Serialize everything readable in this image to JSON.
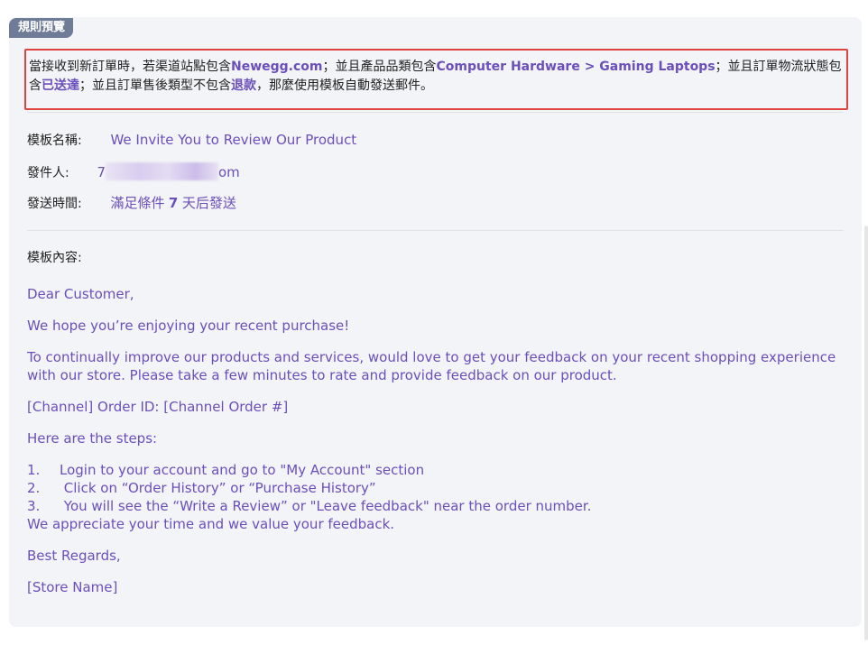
{
  "tab": {
    "label": "規則預覽"
  },
  "rule": {
    "text_1": "當接收到新訂單時，若渠道站點包含",
    "channel": "Newegg.com",
    "text_2": "；並且產品品類包含",
    "category": "Computer Hardware > Gaming Laptops",
    "text_3": "；並且訂單物流狀態包含",
    "logistics": "已送達",
    "text_4": "；並且訂單售後類型不包含",
    "aftersale": "退款",
    "text_5": "，那麼使用模板自動發送郵件。"
  },
  "fields": {
    "template_name_label": "模板名稱:",
    "template_name_value": "We Invite You to Review Our Product",
    "sender_label": "發件人:",
    "sender_prefix": "7",
    "sender_suffix": "om",
    "send_time_label": "發送時間:",
    "send_time_text_1": "滿足條件",
    "send_time_days": "7",
    "send_time_text_2": "天后發送"
  },
  "content": {
    "label": "模板內容:",
    "greeting": "Dear Customer,",
    "line1": "We hope you’re enjoying your recent purchase!",
    "line2a": "To continually improve our products and services, would love to get your feedback on your recent shopping experience",
    "line2b": "with our store. Please take a few minutes to rate and provide feedback on our product.",
    "order_line": "[Channel] Order ID: [Channel Order #]",
    "steps_intro": "Here are the steps:",
    "steps": [
      {
        "num": "1.",
        "text": "Login to your account and go to \"My Account\" section"
      },
      {
        "num": "2.",
        "text": " Click on “Order History” or “Purchase History”"
      },
      {
        "num": "3.",
        "text": " You will see the “Write a Review” or \"Leave feedback\" near the order number."
      }
    ],
    "appreciate": "We appreciate your time and we value your feedback.",
    "regards": "Best Regards,",
    "store_name": "[Store Name]"
  },
  "colors": {
    "accent": "#6b4fbb",
    "rule_border": "#e0443f",
    "tab_bg": "#6f7c98",
    "panel_bg": "#f3f4f7"
  }
}
